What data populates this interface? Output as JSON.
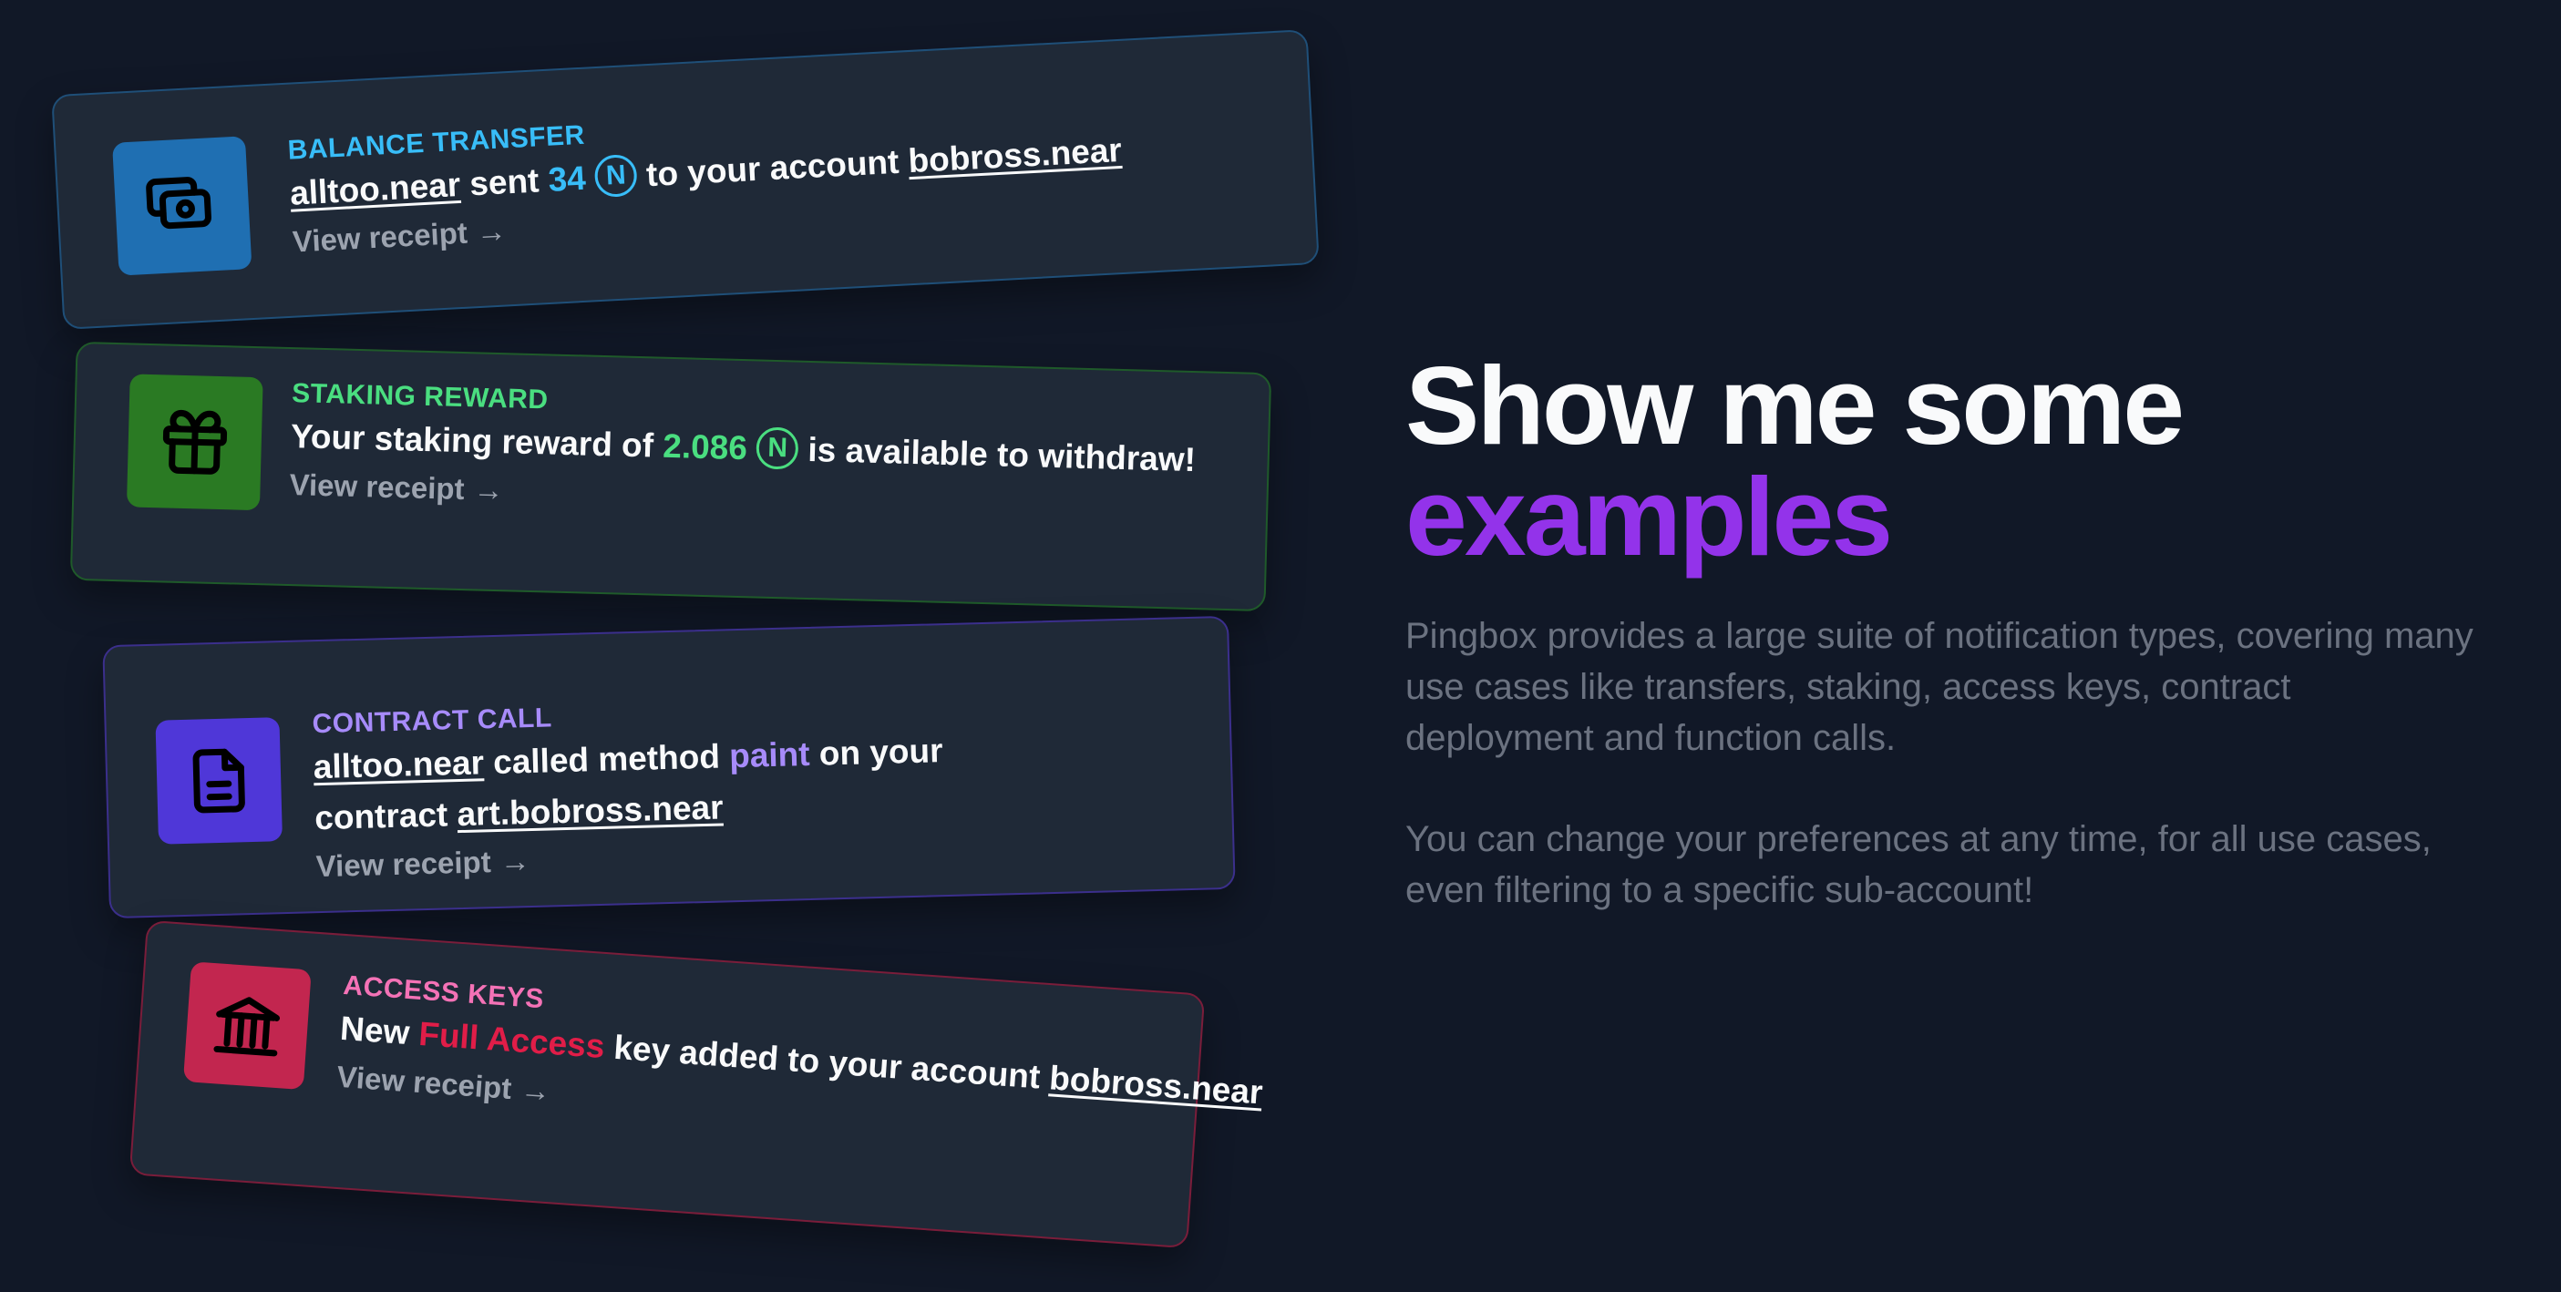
{
  "cards": [
    {
      "type_label": "BALANCE TRANSFER",
      "icon": "cash-icon",
      "accent": "#38bdf8",
      "from_account": "alltoo.near",
      "sent_word": "sent",
      "amount": "34",
      "near_symbol": "N",
      "to_text": "to your account",
      "to_account": "bobross.near",
      "receipt": "View receipt",
      "arrow": "→"
    },
    {
      "type_label": "STAKING REWARD",
      "icon": "gift-icon",
      "accent": "#4ade80",
      "text_before": "Your staking reward of",
      "amount": "2.086",
      "near_symbol": "N",
      "text_after": "is available to withdraw!",
      "receipt": "View receipt",
      "arrow": "→"
    },
    {
      "type_label": "CONTRACT CALL",
      "icon": "document-icon",
      "accent": "#a78bfa",
      "from_account": "alltoo.near",
      "called_text": "called method",
      "method": "paint",
      "on_text": "on your",
      "contract_text": "contract",
      "contract_account": "art.bobross.near",
      "receipt": "View receipt",
      "arrow": "→"
    },
    {
      "type_label": "ACCESS KEYS",
      "icon": "bank-icon",
      "accent": "#e11d48",
      "new_text": "New",
      "key_type": "Full Access",
      "key_text": "key added to your account",
      "account": "bobross.near",
      "receipt": "View receipt",
      "arrow": "→"
    }
  ],
  "headline": {
    "line1": "Show me some",
    "line2": "examples",
    "accent_color": "#9333ea"
  },
  "description": {
    "paragraph1": "Pingbox provides a large suite of notification types, covering many use cases like transfers, staking, access keys, contract deployment and function calls.",
    "paragraph2": "You can change your preferences at any time, for all use cases, even filtering to a specific sub-account!"
  }
}
